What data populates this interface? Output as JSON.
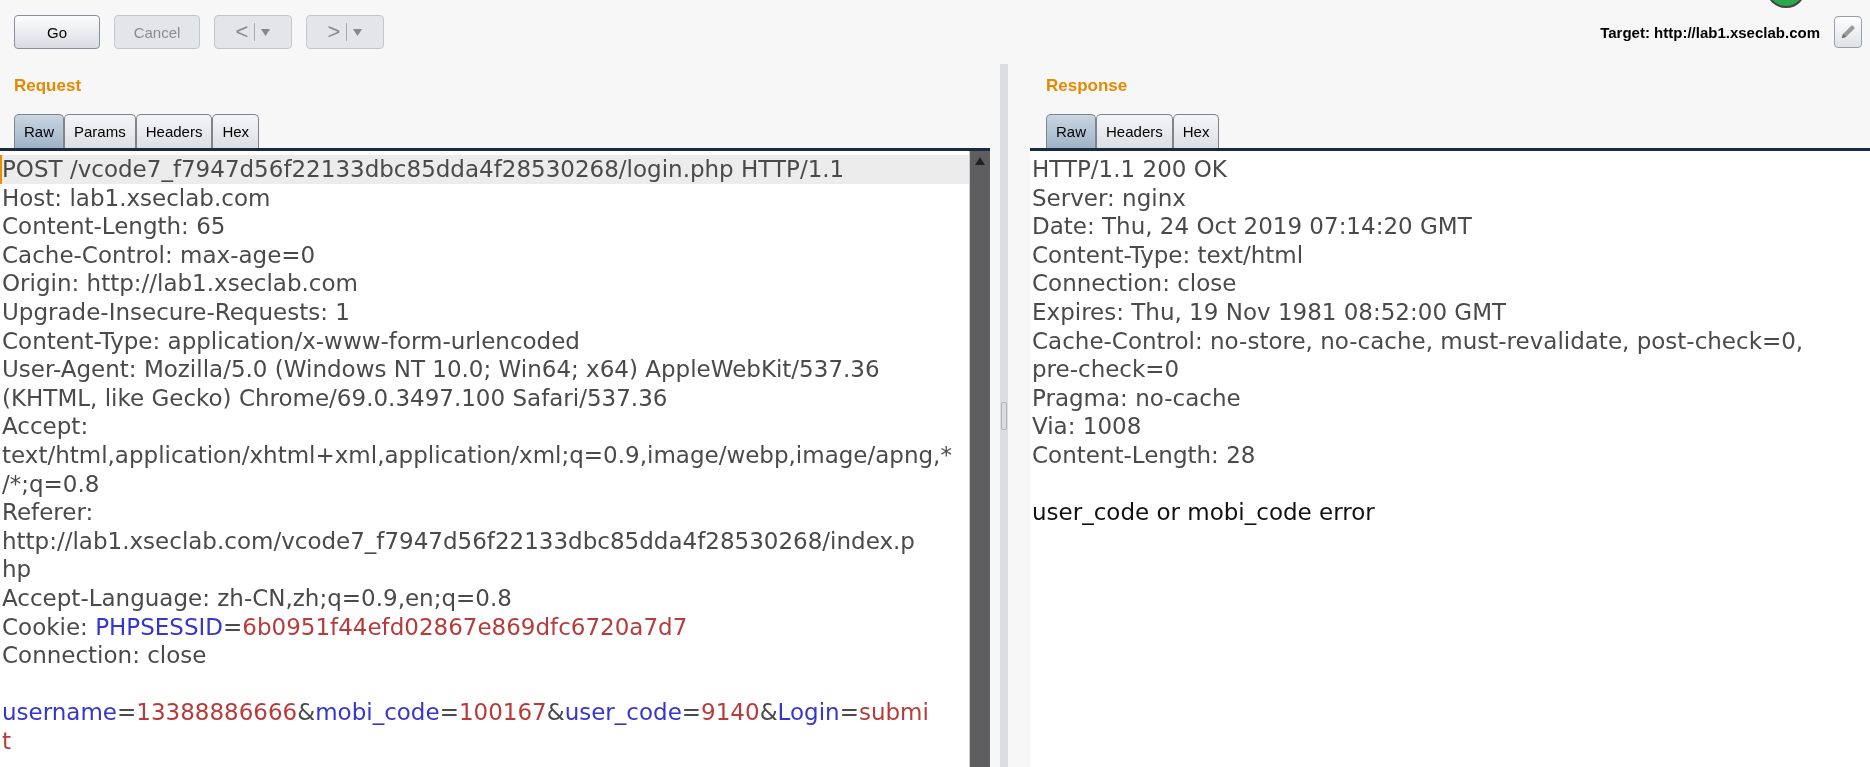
{
  "toolbar": {
    "buttons": [
      {
        "kind": "text",
        "label": "Go",
        "disabled": false
      },
      {
        "kind": "text",
        "label": "Cancel",
        "disabled": true
      },
      {
        "kind": "back",
        "label": "<",
        "disabled": true
      },
      {
        "kind": "forward",
        "label": ">",
        "disabled": true
      }
    ],
    "target": "Target: http://lab1.xseclab.com"
  },
  "request": {
    "title": "Request",
    "tabs": [
      {
        "label": "Raw",
        "selected": true
      },
      {
        "label": "Params",
        "selected": false
      },
      {
        "label": "Headers",
        "selected": false
      },
      {
        "label": "Hex",
        "selected": false
      }
    ],
    "lines": [
      {
        "current": true,
        "segments": [
          {
            "kind": "plain",
            "text": "POST /vcode7_f7947d56f22133dbc85dda4f28530268/login.php HTTP/1.1"
          }
        ]
      },
      {
        "segments": [
          {
            "kind": "plain",
            "text": "Host: lab1.xseclab.com"
          }
        ]
      },
      {
        "segments": [
          {
            "kind": "plain",
            "text": "Content-Length: 65"
          }
        ]
      },
      {
        "segments": [
          {
            "kind": "plain",
            "text": "Cache-Control: max-age=0"
          }
        ]
      },
      {
        "segments": [
          {
            "kind": "plain",
            "text": "Origin: http://lab1.xseclab.com"
          }
        ]
      },
      {
        "segments": [
          {
            "kind": "plain",
            "text": "Upgrade-Insecure-Requests: 1"
          }
        ]
      },
      {
        "segments": [
          {
            "kind": "plain",
            "text": "Content-Type: application/x-www-form-urlencoded"
          }
        ]
      },
      {
        "segments": [
          {
            "kind": "plain",
            "text": "User-Agent: Mozilla/5.0 (Windows NT 10.0; Win64; x64) AppleWebKit/537.36"
          }
        ]
      },
      {
        "segments": [
          {
            "kind": "plain",
            "text": "(KHTML, like Gecko) Chrome/69.0.3497.100 Safari/537.36"
          }
        ]
      },
      {
        "segments": [
          {
            "kind": "plain",
            "text": "Accept:"
          }
        ]
      },
      {
        "segments": [
          {
            "kind": "plain",
            "text": "text/html,application/xhtml+xml,application/xml;q=0.9,image/webp,image/apng,*"
          }
        ]
      },
      {
        "segments": [
          {
            "kind": "plain",
            "text": "/*;q=0.8"
          }
        ]
      },
      {
        "segments": [
          {
            "kind": "plain",
            "text": "Referer:"
          }
        ]
      },
      {
        "segments": [
          {
            "kind": "plain",
            "text": "http://lab1.xseclab.com/vcode7_f7947d56f22133dbc85dda4f28530268/index.p"
          }
        ]
      },
      {
        "segments": [
          {
            "kind": "plain",
            "text": "hp"
          }
        ]
      },
      {
        "segments": [
          {
            "kind": "plain",
            "text": "Accept-Language: zh-CN,zh;q=0.9,en;q=0.8"
          }
        ]
      },
      {
        "segments": [
          {
            "kind": "plain",
            "text": "Cookie: "
          },
          {
            "kind": "name",
            "text": "PHPSESSID"
          },
          {
            "kind": "plain",
            "text": "="
          },
          {
            "kind": "value",
            "text": "6b0951f44efd02867e869dfc6720a7d7"
          }
        ]
      },
      {
        "segments": [
          {
            "kind": "plain",
            "text": "Connection: close"
          }
        ]
      },
      {
        "gap_before": true,
        "segments": [
          {
            "kind": "name",
            "text": "username"
          },
          {
            "kind": "plain",
            "text": "="
          },
          {
            "kind": "value",
            "text": "13388886666"
          },
          {
            "kind": "plain",
            "text": "&"
          },
          {
            "kind": "name",
            "text": "mobi_code"
          },
          {
            "kind": "plain",
            "text": "="
          },
          {
            "kind": "value",
            "text": "100167"
          },
          {
            "kind": "plain",
            "text": "&"
          },
          {
            "kind": "name",
            "text": "user_code"
          },
          {
            "kind": "plain",
            "text": "="
          },
          {
            "kind": "value",
            "text": "9140"
          },
          {
            "kind": "plain",
            "text": "&"
          },
          {
            "kind": "name",
            "text": "Login"
          },
          {
            "kind": "plain",
            "text": "="
          },
          {
            "kind": "value",
            "text": "submi"
          }
        ]
      },
      {
        "segments": [
          {
            "kind": "value",
            "text": "t"
          }
        ]
      }
    ]
  },
  "response": {
    "title": "Response",
    "tabs": [
      {
        "label": "Raw",
        "selected": true
      },
      {
        "label": "Headers",
        "selected": false
      },
      {
        "label": "Hex",
        "selected": false
      }
    ],
    "lines": [
      {
        "segments": [
          {
            "kind": "plain",
            "text": "HTTP/1.1 200 OK"
          }
        ]
      },
      {
        "segments": [
          {
            "kind": "plain",
            "text": "Server: nginx"
          }
        ]
      },
      {
        "segments": [
          {
            "kind": "plain",
            "text": "Date: Thu, 24 Oct 2019 07:14:20 GMT"
          }
        ]
      },
      {
        "segments": [
          {
            "kind": "plain",
            "text": "Content-Type: text/html"
          }
        ]
      },
      {
        "segments": [
          {
            "kind": "plain",
            "text": "Connection: close"
          }
        ]
      },
      {
        "segments": [
          {
            "kind": "plain",
            "text": "Expires: Thu, 19 Nov 1981 08:52:00 GMT"
          }
        ]
      },
      {
        "segments": [
          {
            "kind": "plain",
            "text": "Cache-Control: no-store, no-cache, must-revalidate, post-check=0,"
          }
        ]
      },
      {
        "segments": [
          {
            "kind": "plain",
            "text": "pre-check=0"
          }
        ]
      },
      {
        "segments": [
          {
            "kind": "plain",
            "text": "Pragma: no-cache"
          }
        ]
      },
      {
        "segments": [
          {
            "kind": "plain",
            "text": "Via: 1008"
          }
        ]
      },
      {
        "segments": [
          {
            "kind": "plain",
            "text": "Content-Length: 28"
          }
        ]
      },
      {
        "gap_before": true,
        "segments": [
          {
            "kind": "body",
            "text": "user_code or mobi_code error"
          }
        ]
      }
    ]
  }
}
